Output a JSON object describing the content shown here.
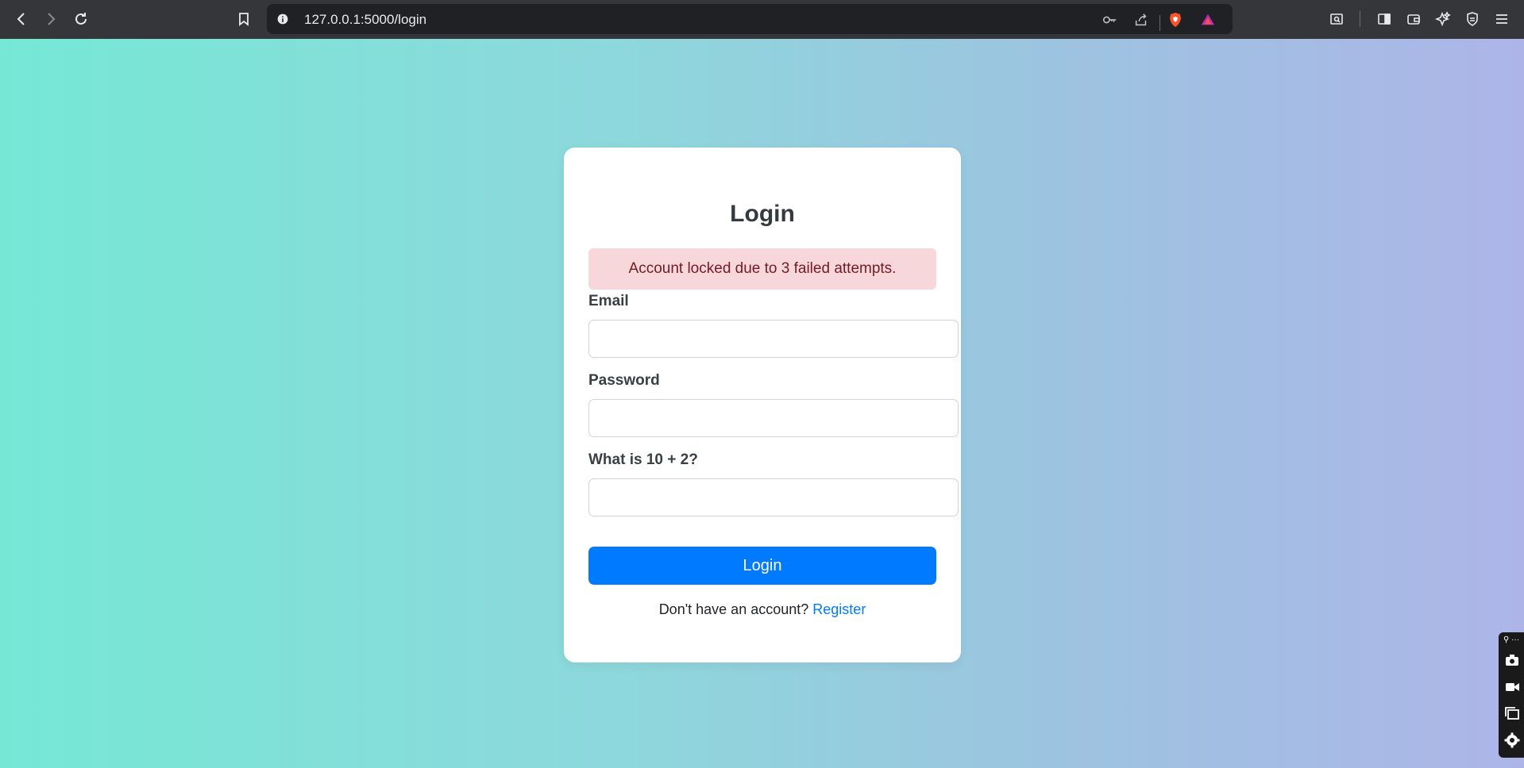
{
  "browser": {
    "url": "127.0.0.1:5000/login",
    "nav": {
      "back": "back-icon",
      "forward": "forward-icon",
      "reload": "reload-icon"
    }
  },
  "login": {
    "title": "Login",
    "alert": "Account locked due to 3 failed attempts.",
    "email_label": "Email",
    "email_value": "",
    "password_label": "Password",
    "password_value": "",
    "captcha_label": "What is 10 + 2?",
    "captcha_value": "",
    "submit_label": "Login",
    "register_prompt": "Don't have an account?",
    "register_link": "Register"
  },
  "colors": {
    "primary": "#007bff",
    "alert_bg": "#f8d7da",
    "alert_text": "#721c24"
  },
  "side_widget": {
    "top_glyph": "⚲ ···"
  }
}
